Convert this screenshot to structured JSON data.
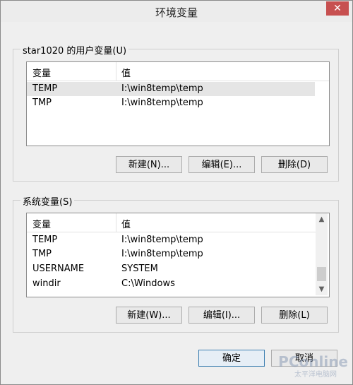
{
  "window": {
    "title": "环境变量",
    "close_label": "✕"
  },
  "user_vars": {
    "group_label": "star1020 的用户变量(U)",
    "columns": [
      "变量",
      "值"
    ],
    "rows": [
      {
        "name": "TEMP",
        "value": "I:\\win8temp\\temp"
      },
      {
        "name": "TMP",
        "value": "I:\\win8temp\\temp"
      }
    ],
    "buttons": {
      "new": "新建(N)...",
      "edit": "编辑(E)...",
      "delete": "删除(D)"
    }
  },
  "system_vars": {
    "group_label": "系统变量(S)",
    "columns": [
      "变量",
      "值"
    ],
    "rows": [
      {
        "name": "TEMP",
        "value": "I:\\win8temp\\temp"
      },
      {
        "name": "TMP",
        "value": "I:\\win8temp\\temp"
      },
      {
        "name": "USERNAME",
        "value": "SYSTEM"
      },
      {
        "name": "windir",
        "value": "C:\\Windows"
      }
    ],
    "buttons": {
      "new": "新建(W)...",
      "edit": "编辑(I)...",
      "delete": "删除(L)"
    }
  },
  "footer": {
    "ok": "确定",
    "cancel": "取消"
  },
  "watermark": {
    "logo": "PConline",
    "caption": "太平洋电脑网"
  }
}
